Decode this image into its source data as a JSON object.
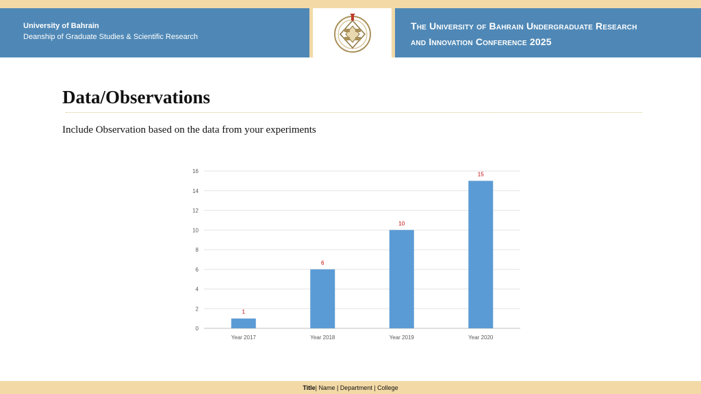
{
  "header": {
    "university": "University of Bahrain",
    "deanship": "Deanship of Graduate Studies & Scientific Research",
    "conference_line1": "The University of Bahrain Undergraduate Research",
    "conference_line2": "and Innovation Conference 2025"
  },
  "main": {
    "title": "Data/Observations",
    "instructions": "Include Observation based on the data from your experiments"
  },
  "footer": {
    "title_label": "Title",
    "rest": "| Name | Department | College"
  },
  "colors": {
    "banner": "#4f88b6",
    "gold": "#f2d9a6",
    "bar": "#5b9bd5",
    "data_label": "#c00000"
  },
  "chart_data": {
    "type": "bar",
    "categories": [
      "Year 2017",
      "Year 2018",
      "Year 2019",
      "Year 2020"
    ],
    "values": [
      1,
      6,
      10,
      15
    ],
    "data_labels": [
      "1",
      "6",
      "10",
      "15"
    ],
    "yticks": [
      "0",
      "2",
      "4",
      "6",
      "8",
      "10",
      "12",
      "14",
      "16"
    ],
    "ylim": [
      0,
      16
    ],
    "grid": true,
    "legend": "none",
    "title": "",
    "xlabel": "",
    "ylabel": ""
  }
}
